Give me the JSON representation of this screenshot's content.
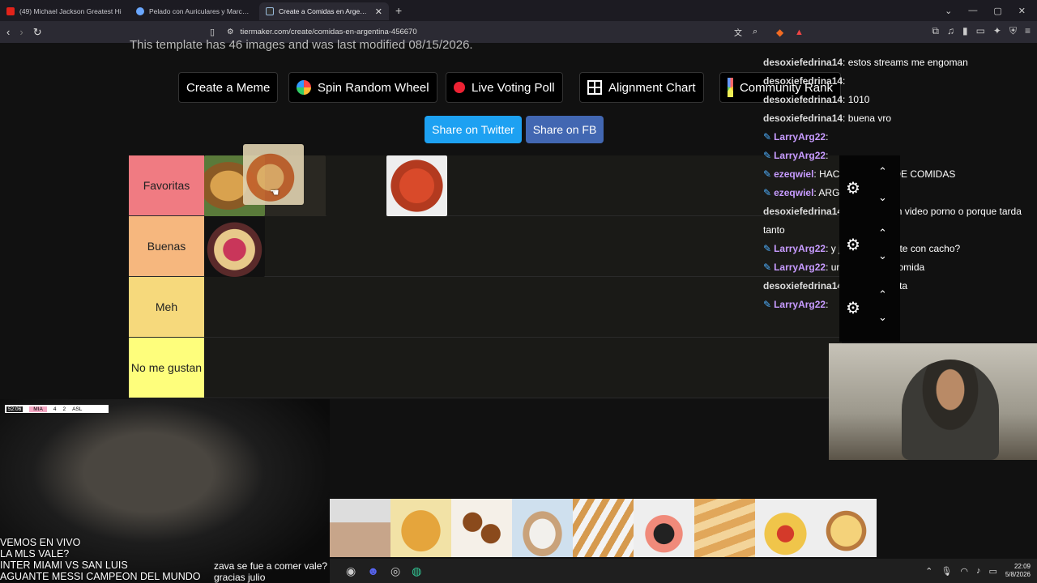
{
  "browser": {
    "tabs": [
      {
        "label": "(49) Michael Jackson Greatest Hi",
        "active": false,
        "color": "#e2231a"
      },
      {
        "label": "Pelado con Auriculares y Marcador -",
        "active": false,
        "color": "#6aa7ff"
      },
      {
        "label": "Create a Comidas en Argentina",
        "active": true,
        "color": "#9bd"
      }
    ],
    "url": "tiermaker.com/create/comidas-en-argentina-456670"
  },
  "page": {
    "last_modified": "This template has 46 images and was last modified 08/15/2026.",
    "buttons": {
      "create_meme": "Create a Meme",
      "spin_wheel": "Spin Random Wheel",
      "live_poll": "Live Voting Poll",
      "alignment": "Alignment Chart",
      "community": "Community Rank"
    },
    "share_twitter": "Share on Twitter",
    "share_fb": "Share on FB",
    "tiers": [
      {
        "label": "Favoritas",
        "color": "#f07b82"
      },
      {
        "label": "Buenas",
        "color": "#f6b77e"
      },
      {
        "label": "Meh",
        "color": "#f6d97c"
      },
      {
        "label": "No me gustan",
        "color": "#fefe7c"
      }
    ]
  },
  "chat": [
    {
      "user": "desoxiefedrina14",
      "text": ": estos streams me engoman",
      "badge": false,
      "style": "u1"
    },
    {
      "user": "desoxiefedrina14",
      "text": ":",
      "badge": false,
      "style": "u1"
    },
    {
      "user": "desoxiefedrina14",
      "text": ": 1010",
      "badge": false,
      "style": "u1"
    },
    {
      "user": "desoxiefedrina14",
      "text": ": buena vro",
      "badge": false,
      "style": "u1"
    },
    {
      "user": "LarryArg22",
      "text": ":",
      "badge": true,
      "style": "u2"
    },
    {
      "user": "LarryArg22",
      "text": ":",
      "badge": true,
      "style": "u2"
    },
    {
      "user": "ezeqwiel",
      "text": ": HACE TIERLIST DE COMIDAS",
      "badge": true,
      "style": "u2"
    },
    {
      "user": "ezeqwiel",
      "text": ": ARGENTINAS",
      "badge": true,
      "style": "u2"
    },
    {
      "user": "desoxiefedrina14",
      "text": ": renderizo un video porno o porque tarda",
      "badge": false,
      "style": "u1"
    },
    {
      "user": "",
      "text": "tanto",
      "badge": false,
      "style": "u1"
    },
    {
      "user": "LarryArg22",
      "text": ": y jugamos roulete con cacho?",
      "badge": true,
      "style": "u2"
    },
    {
      "user": "LarryArg22",
      "text": ": una banda de comida",
      "badge": true,
      "style": "u2"
    },
    {
      "user": "desoxiefedrina14",
      "text": ": pareciera frita",
      "badge": false,
      "style": "u1"
    },
    {
      "user": "LarryArg22",
      "text": ":",
      "badge": true,
      "style": "u2"
    }
  ],
  "stream": {
    "score": {
      "time": "52:06",
      "team1": "MIA",
      "s1": "4",
      "s2": "2",
      "team2": "ASL"
    },
    "overlay_lines": [
      "VEMOS EN VIVO",
      "LA MLS VALE?",
      "INTER MIAMI VS SAN LUIS",
      "AGUANTE MESSI CAMPEON DEL MUNDO"
    ],
    "bottom_chat": [
      "zava se fue a comer vale?",
      "gracias julio"
    ]
  },
  "taskbar": {
    "time": "22:09",
    "date": "5/8/2026"
  }
}
